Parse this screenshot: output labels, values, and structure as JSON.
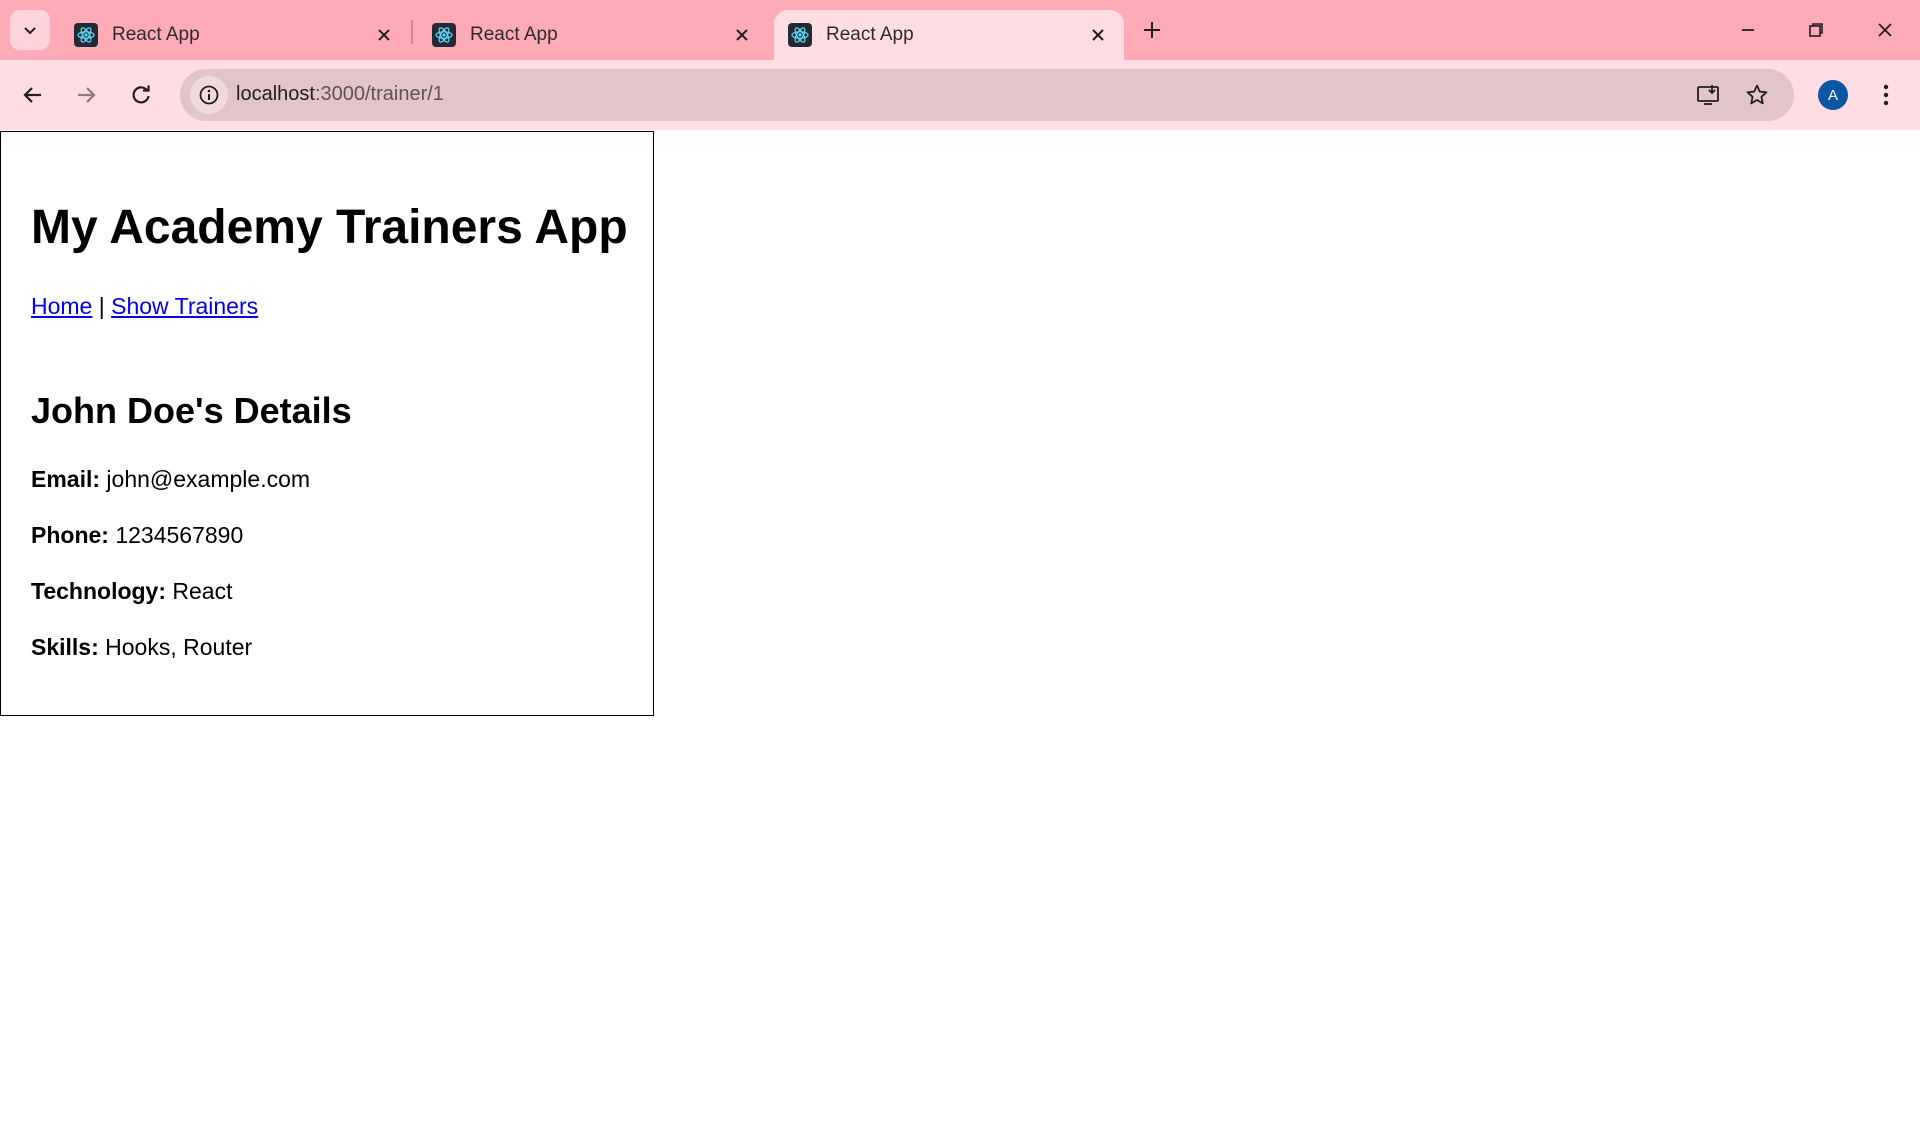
{
  "browser": {
    "tabs": [
      {
        "title": "React App",
        "active": false
      },
      {
        "title": "React App",
        "active": false
      },
      {
        "title": "React App",
        "active": true
      }
    ],
    "url_host": "localhost",
    "url_path": ":3000/trainer/1",
    "profile_initial": "A",
    "colors": {
      "frame": "#ffabb7",
      "toolbar": "#ffdde3",
      "omnibox": "#e2c5ca",
      "avatar": "#0b57a6"
    }
  },
  "app": {
    "title": "My Academy Trainers App",
    "nav": {
      "home": "Home",
      "separator": "|",
      "show_trainers": "Show Trainers"
    },
    "details_title": "John Doe's Details",
    "details": [
      {
        "label": "Email:",
        "value": "john@example.com"
      },
      {
        "label": "Phone:",
        "value": "1234567890"
      },
      {
        "label": "Technology:",
        "value": "React"
      },
      {
        "label": "Skills:",
        "value": "Hooks, Router"
      }
    ],
    "link_color": "#0000ee"
  }
}
